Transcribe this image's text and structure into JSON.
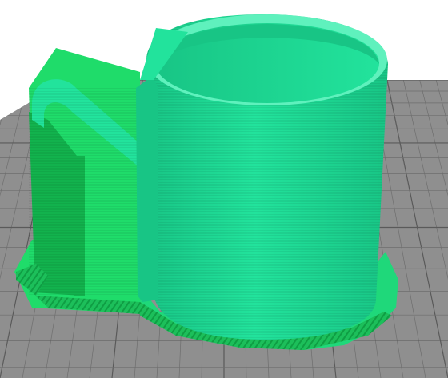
{
  "viewport": {
    "background": "#ffffff",
    "bed_color": "#8f8f8f",
    "bed_grid_line_color": "#6e6e6e",
    "bed_grid_major_color": "#5a5a5a"
  },
  "model": {
    "shell_color": "#22e39c",
    "shell_shadow_color": "#18c585",
    "shell_highlight_color": "#5ff1bd",
    "support_color": "#1fdc6a",
    "support_dark_color": "#12b24d",
    "brim_color": "#1fd87a"
  }
}
